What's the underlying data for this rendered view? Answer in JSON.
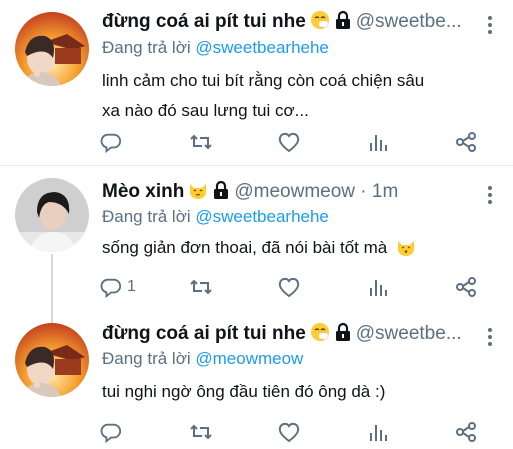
{
  "tweets": [
    {
      "name": "đừng coá ai pít tui nhe",
      "handle": "@sweetbe...",
      "reply_prefix": "Đang trả lời",
      "reply_to": "@sweetbearhehe",
      "lines": [
        "linh cảm cho tui bít rằng còn coá chiện sâu",
        "xa nào đó sau lưng tui cơ..."
      ],
      "reply_count": ""
    },
    {
      "name": "Mèo xinh",
      "handle": "@meowmeow · 1m",
      "reply_prefix": "Đang trả lời",
      "reply_to": "@sweetbearhehe",
      "lines": [
        "sống giản đơn thoai, đã nói bài tốt mà"
      ],
      "reply_count": "1"
    },
    {
      "name": "đừng coá ai pít tui nhe",
      "handle": "@sweetbe...",
      "reply_prefix": "Đang trả lời",
      "reply_to": "@meowmeow",
      "lines": [
        "tui nghi ngờ ông đầu tiên đó ông dà :)"
      ],
      "reply_count": ""
    }
  ],
  "icons": {
    "name_emoji_1": "sneezing-face-emoji",
    "name_emoji_2": "lock-icon",
    "name_emoji_cat": "cat-face-emoji",
    "body_emoji_cat": "kissing-cat-emoji",
    "actions": [
      "reply-icon",
      "retweet-icon",
      "like-icon",
      "stats-icon",
      "share-icon"
    ]
  },
  "colors": {
    "handle": "#5b7083",
    "mention": "#1d9bf0",
    "divider": "#e6ecf0",
    "thread_line": "#cfd9de"
  }
}
